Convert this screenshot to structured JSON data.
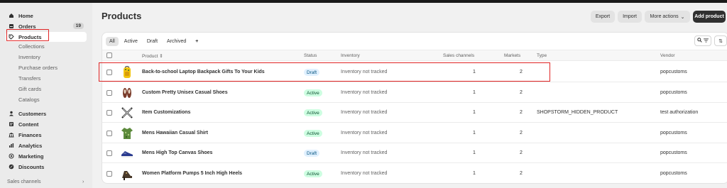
{
  "sidebar": {
    "items": [
      {
        "label": "Home",
        "icon": "home-icon"
      },
      {
        "label": "Orders",
        "icon": "orders-icon",
        "count": "19"
      },
      {
        "label": "Products",
        "icon": "tag-icon"
      },
      {
        "label": "Customers",
        "icon": "person-icon"
      },
      {
        "label": "Content",
        "icon": "content-icon"
      },
      {
        "label": "Finances",
        "icon": "bank-icon"
      },
      {
        "label": "Analytics",
        "icon": "chart-icon"
      },
      {
        "label": "Marketing",
        "icon": "target-icon"
      },
      {
        "label": "Discounts",
        "icon": "discount-icon"
      }
    ],
    "product_subitems": [
      "Collections",
      "Inventory",
      "Purchase orders",
      "Transfers",
      "Gift cards",
      "Catalogs"
    ],
    "sales_channels": "Sales channels"
  },
  "header": {
    "title": "Products",
    "export": "Export",
    "import": "Import",
    "more_actions": "More actions",
    "add_product": "Add product"
  },
  "tabs": [
    "All",
    "Active",
    "Draft",
    "Archived",
    "+"
  ],
  "columns": {
    "product": "Product",
    "status": "Status",
    "inventory": "Inventory",
    "sales_channels": "Sales channels",
    "markets": "Markets",
    "type": "Type",
    "vendor": "Vendor"
  },
  "rows": [
    {
      "name": "Back-to-school Laptop Backpack Gifts To Your Kids",
      "status": "Draft",
      "inventory": "Inventory not tracked",
      "sales_channels": "1",
      "markets": "2",
      "type": "",
      "vendor": "popcustoms"
    },
    {
      "name": "Custom Pretty Unisex Casual Shoes",
      "status": "Active",
      "inventory": "Inventory not tracked",
      "sales_channels": "1",
      "markets": "2",
      "type": "",
      "vendor": "popcustoms"
    },
    {
      "name": "Item Customizations",
      "status": "Active",
      "inventory": "Inventory not tracked",
      "sales_channels": "1",
      "markets": "2",
      "type": "SHOPSTORM_HIDDEN_PRODUCT",
      "vendor": "test authorization"
    },
    {
      "name": "Mens Hawaiian Casual Shirt",
      "status": "Active",
      "inventory": "Inventory not tracked",
      "sales_channels": "1",
      "markets": "2",
      "type": "",
      "vendor": "popcustoms"
    },
    {
      "name": "Mens High Top Canvas Shoes",
      "status": "Draft",
      "inventory": "Inventory not tracked",
      "sales_channels": "1",
      "markets": "2",
      "type": "",
      "vendor": "popcustoms"
    },
    {
      "name": "Women Platform Pumps 5 Inch High Heels",
      "status": "Active",
      "inventory": "Inventory not tracked",
      "sales_channels": "1",
      "markets": "2",
      "type": "",
      "vendor": "popcustoms"
    }
  ]
}
